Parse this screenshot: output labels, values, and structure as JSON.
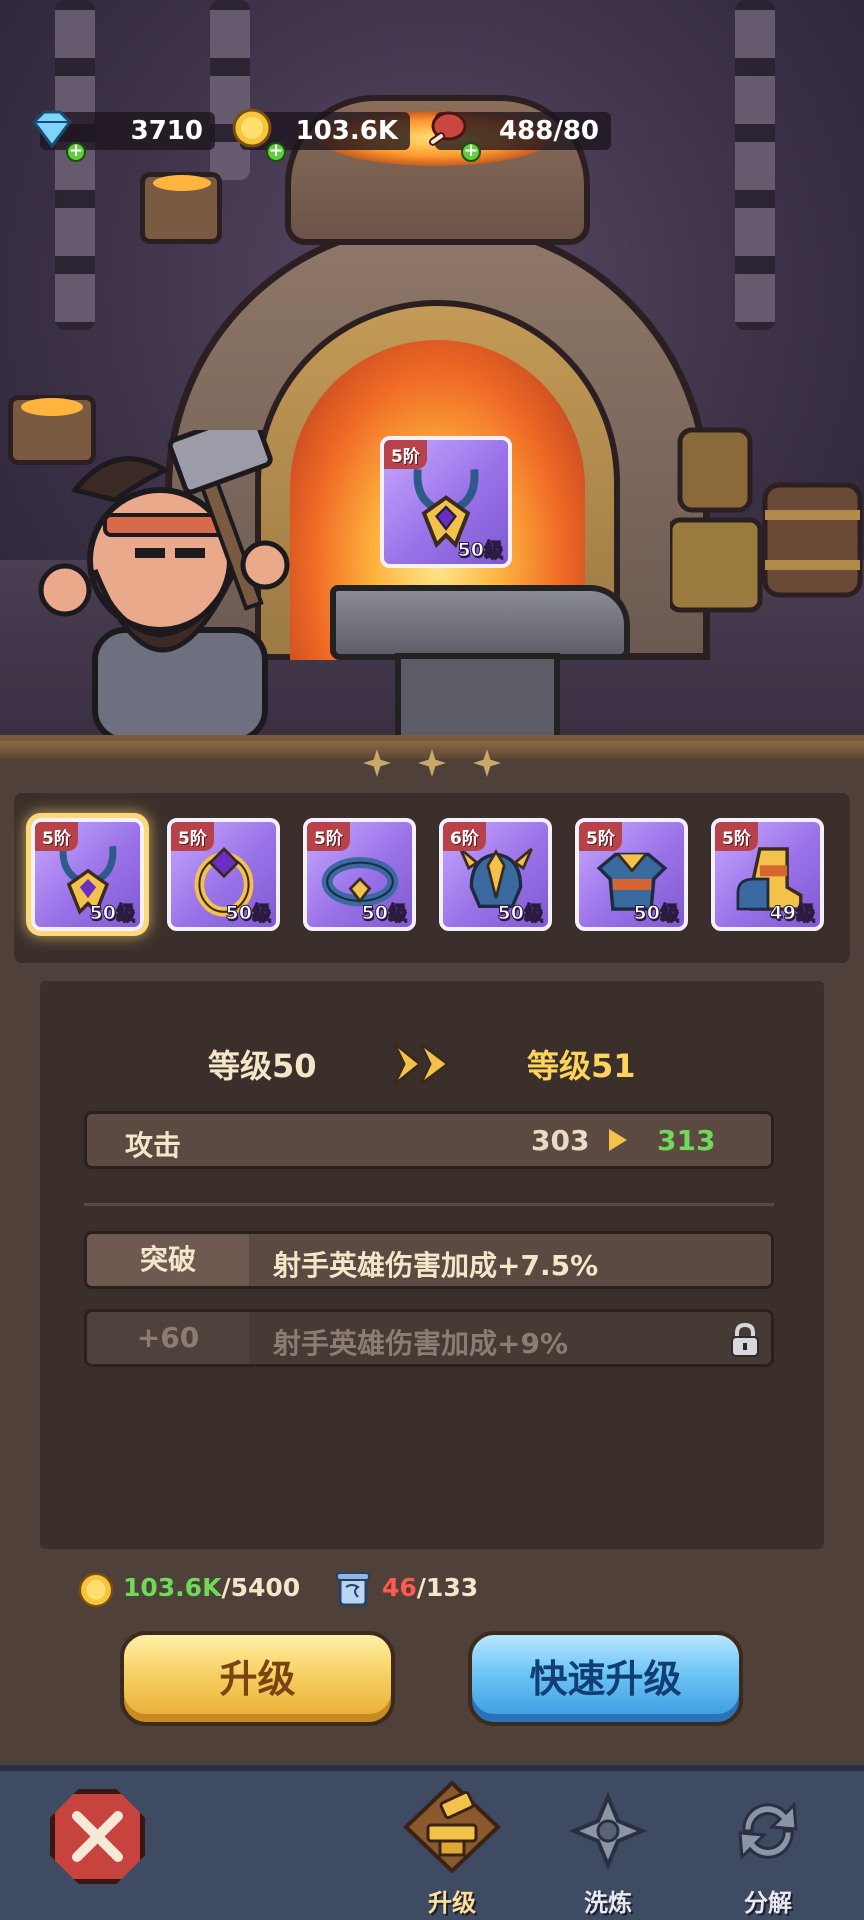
{
  "resources": {
    "gems": "3710",
    "gold": "103.6K",
    "food": "488/80"
  },
  "forge": {
    "current_item": {
      "tier": "5阶",
      "level": "50级"
    }
  },
  "equipment_slots": [
    {
      "tier": "5阶",
      "level": "50级",
      "icon": "amulet-icon",
      "selected": true
    },
    {
      "tier": "5阶",
      "level": "50级",
      "icon": "ring-icon"
    },
    {
      "tier": "5阶",
      "level": "50级",
      "icon": "bracelet-icon"
    },
    {
      "tier": "6阶",
      "level": "50级",
      "icon": "helmet-icon"
    },
    {
      "tier": "5阶",
      "level": "50级",
      "icon": "armor-icon"
    },
    {
      "tier": "5阶",
      "level": "49级",
      "icon": "boots-icon"
    }
  ],
  "upgrade": {
    "current_level": "等级50",
    "next_level": "等级51",
    "attack": {
      "label": "攻击",
      "current": "303",
      "next": "313"
    },
    "breakthrough": {
      "tag": "突破",
      "text": "射手英雄伤害加成+7.5%"
    },
    "locked_bonus": {
      "tag": "+60",
      "text": "射手英雄伤害加成+9%"
    }
  },
  "cost": {
    "gold_have": "103.6K",
    "gold_need": "/5400",
    "scroll_have": "46",
    "scroll_need": "/133"
  },
  "buttons": {
    "upgrade": "升级",
    "quick_upgrade": "快速升级"
  },
  "nav": {
    "upgrade": "升级",
    "refine": "洗炼",
    "decompose": "分解"
  },
  "colors": {
    "item_purple": "#9a72e8",
    "gain_green": "#6fd95a",
    "short_red": "#ff5a4e",
    "upgrade_gold": "#f7d063",
    "quick_blue": "#6cc4f5"
  }
}
